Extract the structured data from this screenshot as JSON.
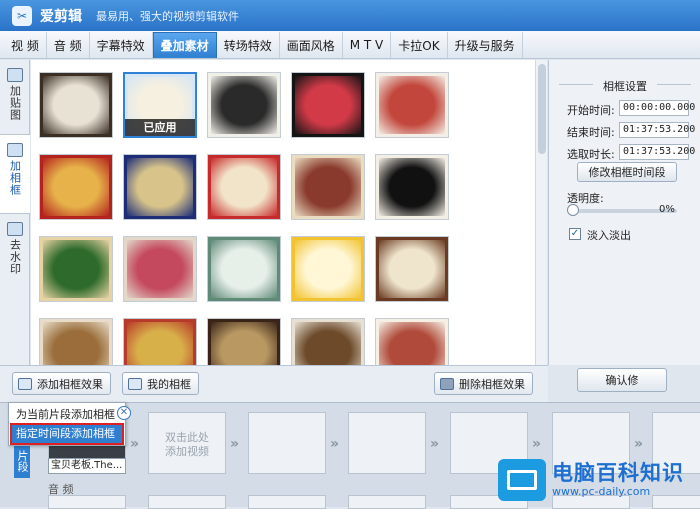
{
  "titlebar": {
    "app_name": "爱剪辑",
    "subtitle": "最易用、强大的视频剪辑软件"
  },
  "tabs": [
    {
      "label": "视  频",
      "active": false
    },
    {
      "label": "音  频",
      "active": false
    },
    {
      "label": "字幕特效",
      "active": false
    },
    {
      "label": "叠加素材",
      "active": true
    },
    {
      "label": "转场特效",
      "active": false
    },
    {
      "label": "画面风格",
      "active": false
    },
    {
      "label": "M T V",
      "active": false
    },
    {
      "label": "卡拉OK",
      "active": false
    },
    {
      "label": "升级与服务",
      "active": false
    }
  ],
  "leftbar": [
    {
      "label": "加贴图",
      "active": false
    },
    {
      "label": "加相框",
      "active": true
    },
    {
      "label": "去水印",
      "active": false
    }
  ],
  "frames": {
    "applied_label": "已应用",
    "selected_index": 1
  },
  "toolbar": {
    "add_frame": "添加相框效果",
    "my_frames": "我的相框",
    "delete_frame": "删除相框效果"
  },
  "settings": {
    "title": "相框设置",
    "start_label": "开始时间:",
    "start_value": "00:00:00.000",
    "end_label": "结束时间:",
    "end_value": "01:37:53.200",
    "duration_label": "选取时长:",
    "duration_value": "01:37:53.200",
    "modify_button": "修改相框时间段",
    "opacity_label": "透明度:",
    "opacity_value": "0%",
    "fade_label": "淡入淡出",
    "fade_checked": true,
    "confirm_button": "确认修"
  },
  "popup": {
    "item1": "为当前片段添加相框",
    "item2": "指定时间段添加相框"
  },
  "timeline": {
    "placeholder": "双击此处\n添加视频",
    "clip_label": "宝贝老板.The...",
    "audio_label": "音 频",
    "side_tag": "片段"
  },
  "watermark": {
    "title": "电脑百科知识",
    "url": "www.pc-daily.com"
  },
  "colors": {
    "accent": "#2f7fd0",
    "highlight_border": "#e02020"
  }
}
